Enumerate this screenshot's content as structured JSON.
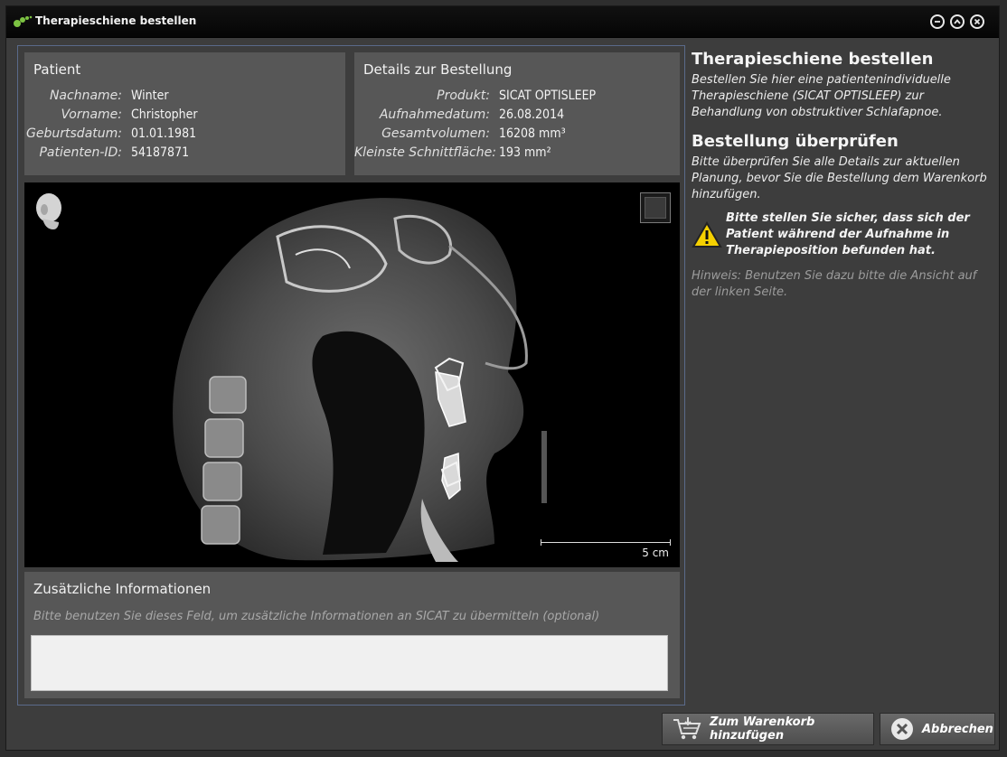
{
  "window": {
    "title": "Therapieschiene bestellen"
  },
  "patient": {
    "heading": "Patient",
    "rows": [
      {
        "label": "Nachname:",
        "value": "Winter"
      },
      {
        "label": "Vorname:",
        "value": "Christopher"
      },
      {
        "label": "Geburtsdatum:",
        "value": "01.01.1981"
      },
      {
        "label": "Patienten-ID:",
        "value": "54187871"
      }
    ]
  },
  "order_details": {
    "heading": "Details zur Bestellung",
    "rows": [
      {
        "label": "Produkt:",
        "value": "SICAT OPTISLEEP"
      },
      {
        "label": "Aufnahmedatum:",
        "value": "26.08.2014"
      },
      {
        "label": "Gesamtvolumen:",
        "value": "16208 mm³"
      },
      {
        "label": "Kleinste Schnittfläche:",
        "value": "193 mm²"
      }
    ]
  },
  "viewer": {
    "scale_label": "5 cm",
    "icons": [
      "head-orientation-icon",
      "layout-toggle-icon"
    ]
  },
  "additional_info": {
    "heading": "Zusätzliche Informationen",
    "hint": "Bitte benutzen Sie dieses Feld, um zusätzliche Informationen an SICAT zu übermitteln (optional)",
    "value": ""
  },
  "sidebar": {
    "title": "Therapieschiene bestellen",
    "description": "Bestellen Sie hier eine patientenindividuelle Therapieschiene (SICAT OPTISLEEP) zur Behandlung von obstruktiver Schlafapnoe.",
    "review_heading": "Bestellung überprüfen",
    "review_text": "Bitte überprüfen Sie alle Details zur aktuellen Planung, bevor Sie die Bestellung dem Warenkorb hinzufügen.",
    "warning": "Bitte stellen Sie sicher, dass sich der Patient während der Aufnahme in Therapieposition befunden hat.",
    "hint": "Hinweis: Benutzen Sie dazu bitte die Ansicht auf der linken Seite."
  },
  "buttons": {
    "add_to_cart": "Zum Warenkorb hinzufügen",
    "cancel": "Abbrechen"
  },
  "colors": {
    "accent_green": "#7cc242",
    "warning_yellow": "#f5d000",
    "panel_bg": "#575757"
  }
}
